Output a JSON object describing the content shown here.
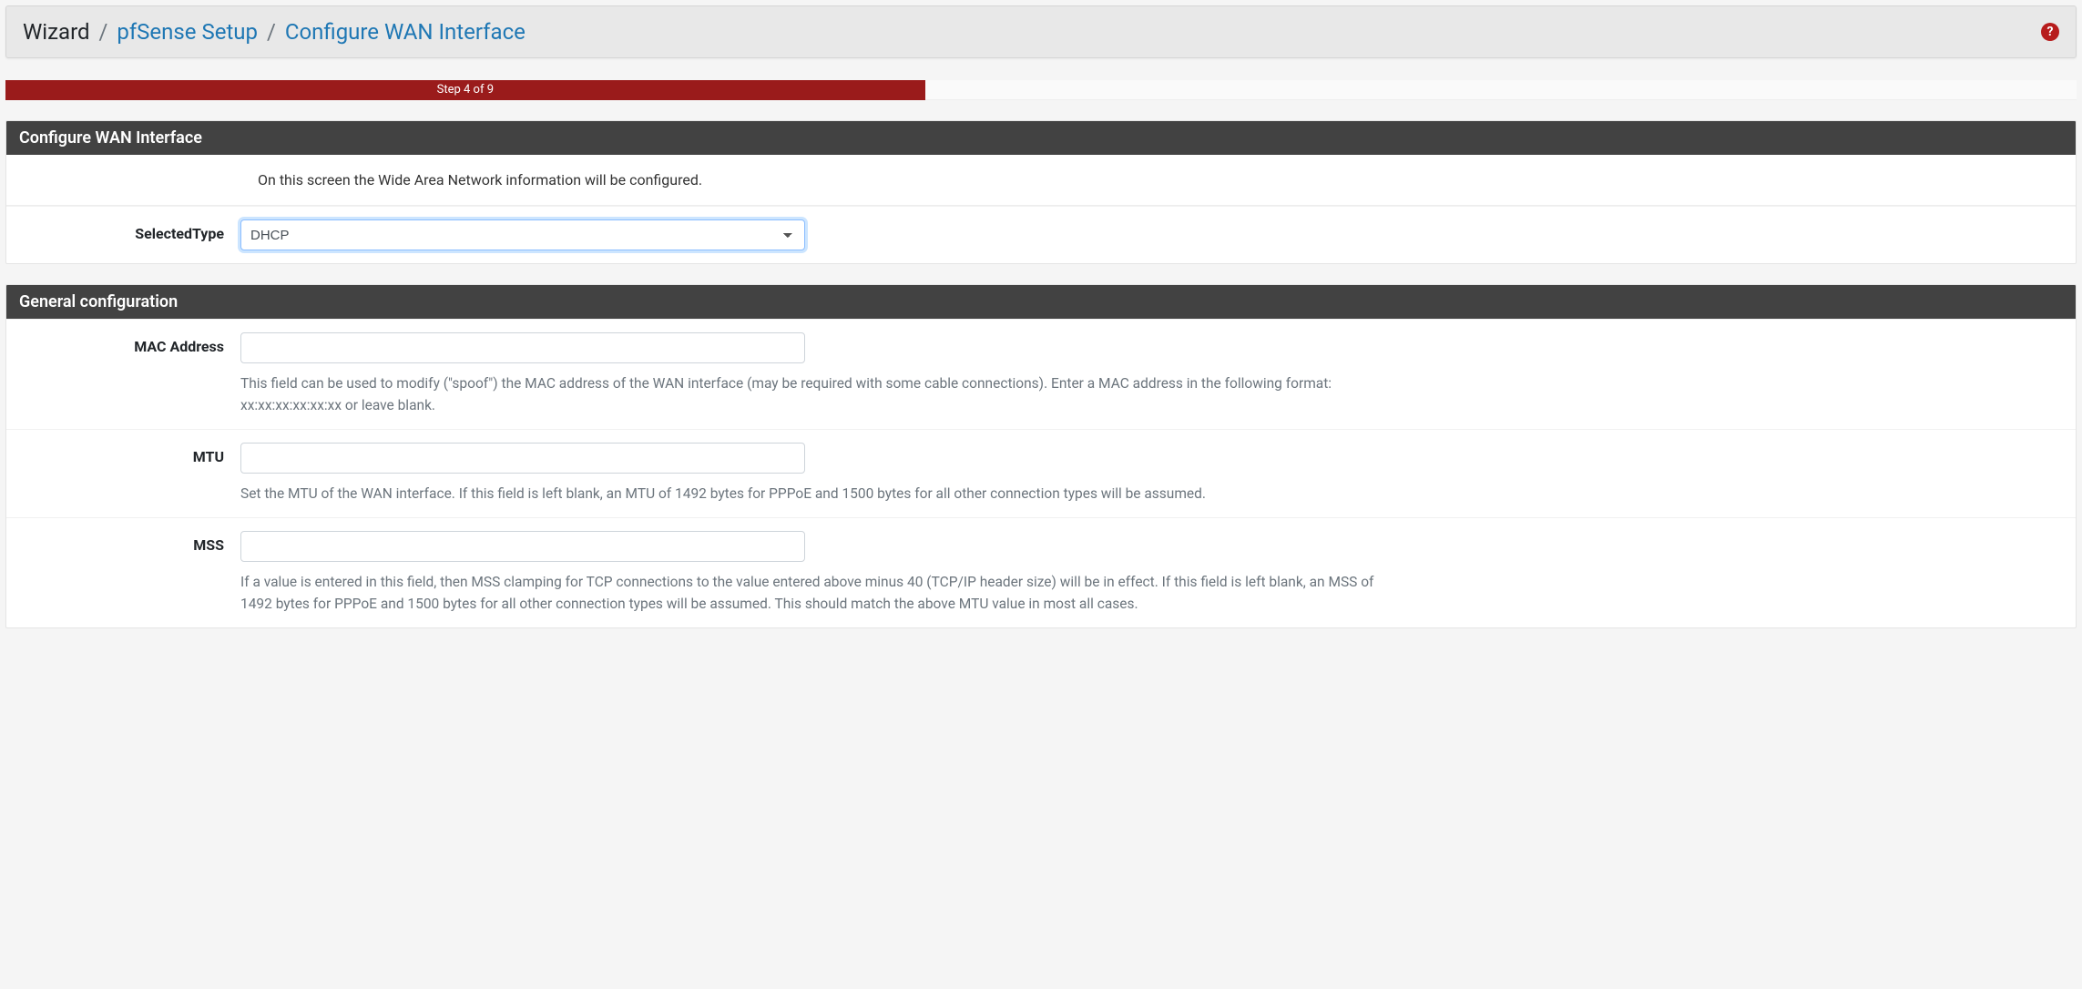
{
  "breadcrumb": {
    "root": "Wizard",
    "mid": "pfSense Setup",
    "current": "Configure WAN Interface"
  },
  "progress": {
    "label": "Step 4 of 9",
    "percent": 44.4
  },
  "panel1": {
    "title": "Configure WAN Interface",
    "intro": "On this screen the Wide Area Network information will be configured.",
    "selected_type": {
      "label": "SelectedType",
      "value": "DHCP"
    }
  },
  "panel2": {
    "title": "General configuration",
    "mac": {
      "label": "MAC Address",
      "value": "",
      "help": "This field can be used to modify (\"spoof\") the MAC address of the WAN interface (may be required with some cable connections). Enter a MAC address in the following format: xx:xx:xx:xx:xx:xx or leave blank."
    },
    "mtu": {
      "label": "MTU",
      "value": "",
      "help": "Set the MTU of the WAN interface. If this field is left blank, an MTU of 1492 bytes for PPPoE and 1500 bytes for all other connection types will be assumed."
    },
    "mss": {
      "label": "MSS",
      "value": "",
      "help": "If a value is entered in this field, then MSS clamping for TCP connections to the value entered above minus 40 (TCP/IP header size) will be in effect. If this field is left blank, an MSS of 1492 bytes for PPPoE and 1500 bytes for all other connection types will be assumed. This should match the above MTU value in most all cases."
    }
  }
}
